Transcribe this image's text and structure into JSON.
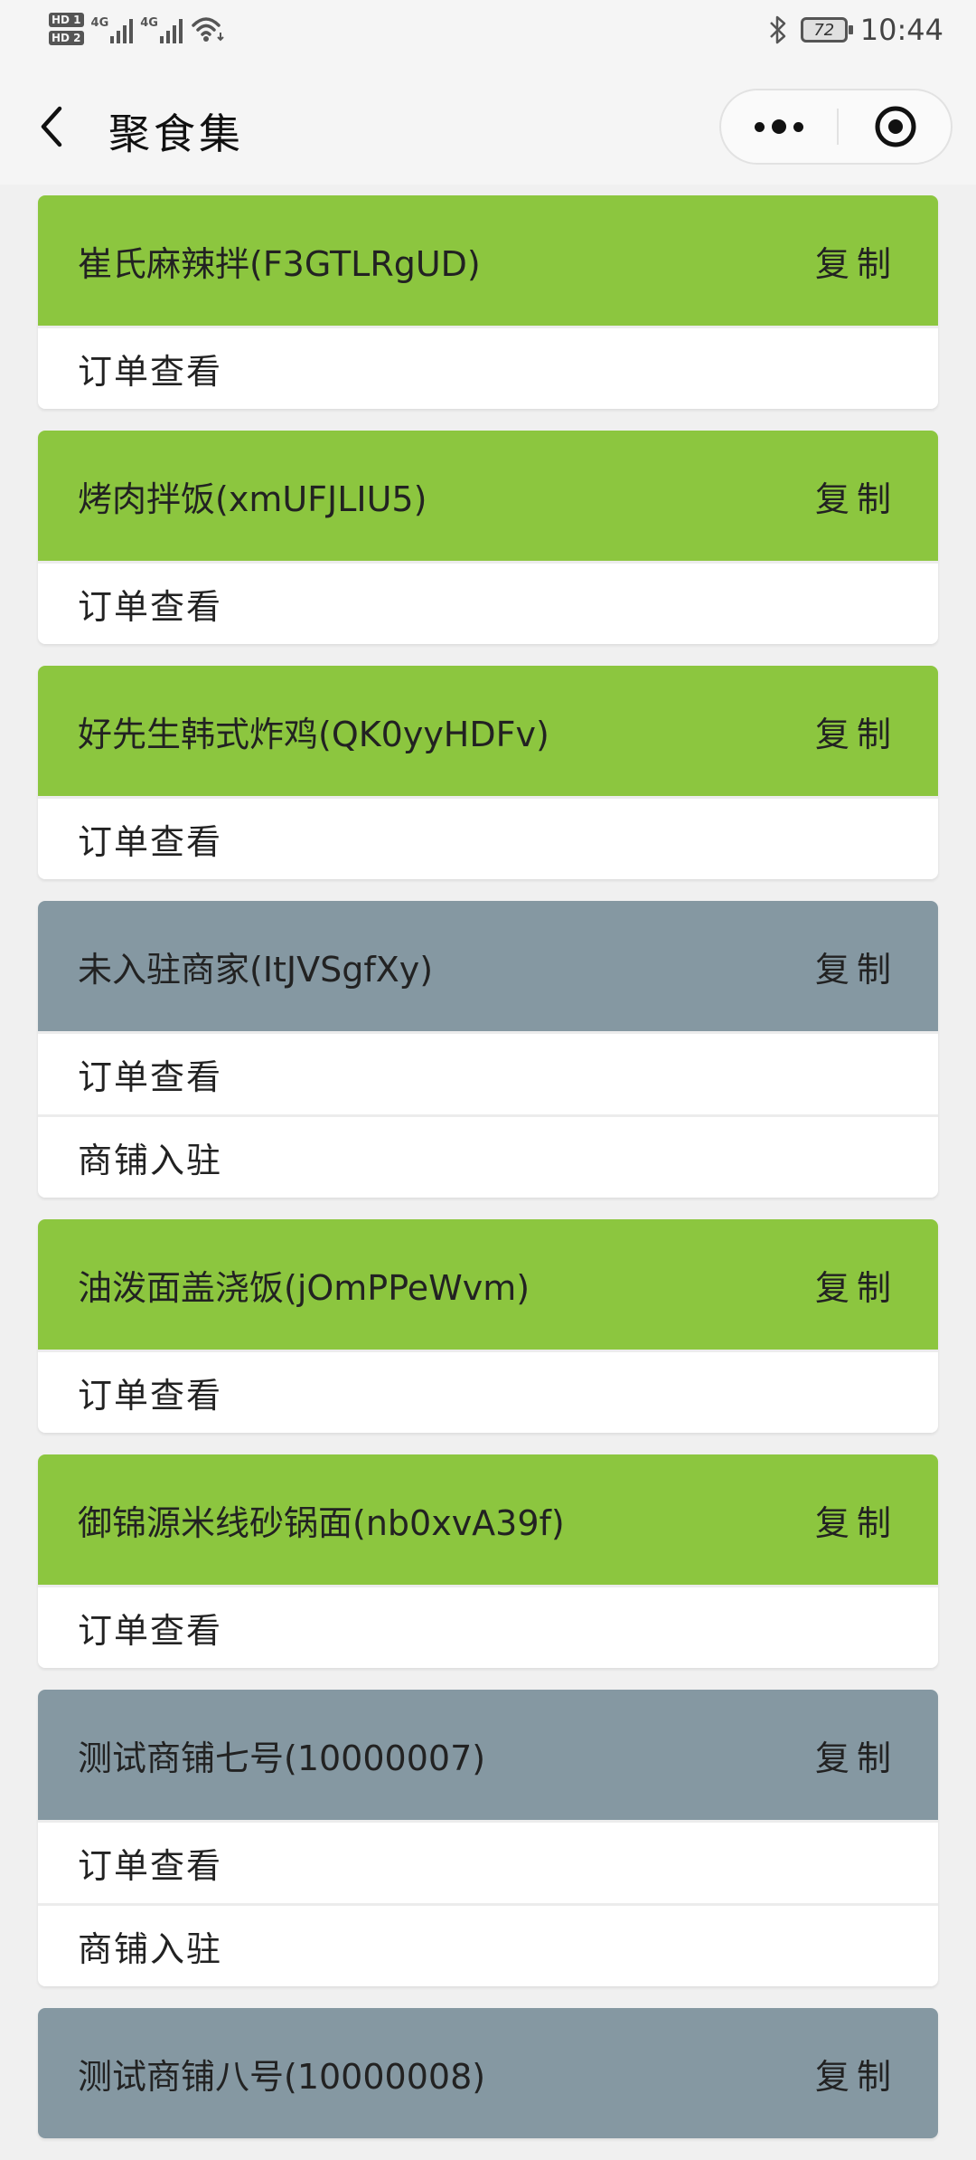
{
  "status_bar": {
    "sim1": "HD 1",
    "sim2": "HD 2",
    "net1": "4G",
    "net2": "4G",
    "battery": "72",
    "time": "10:44"
  },
  "header": {
    "title": "聚食集"
  },
  "copy_label": "复制",
  "shops": [
    {
      "name": "崔氏麻辣拌(F3GTLRgUD)",
      "status": "green",
      "actions": [
        "订单查看"
      ]
    },
    {
      "name": "烤肉拌饭(xmUFJLIU5)",
      "status": "green",
      "actions": [
        "订单查看"
      ]
    },
    {
      "name": "好先生韩式炸鸡(QK0yyHDFv)",
      "status": "green",
      "actions": [
        "订单查看"
      ]
    },
    {
      "name": "未入驻商家(ItJVSgfXy)",
      "status": "gray",
      "actions": [
        "订单查看",
        "商铺入驻"
      ]
    },
    {
      "name": "油泼面盖浇饭(jOmPPeWvm)",
      "status": "green",
      "actions": [
        "订单查看"
      ]
    },
    {
      "name": "御锦源米线砂锅面(nb0xvA39f)",
      "status": "green",
      "actions": [
        "订单查看"
      ]
    },
    {
      "name": "测试商铺七号(10000007)",
      "status": "gray",
      "actions": [
        "订单查看",
        "商铺入驻"
      ]
    },
    {
      "name": "测试商铺八号(10000008)",
      "status": "gray",
      "actions": []
    }
  ],
  "colors": {
    "active_header": "#8cc63f",
    "inactive_header": "#8598a2",
    "page_bg": "#f0f0f0"
  }
}
